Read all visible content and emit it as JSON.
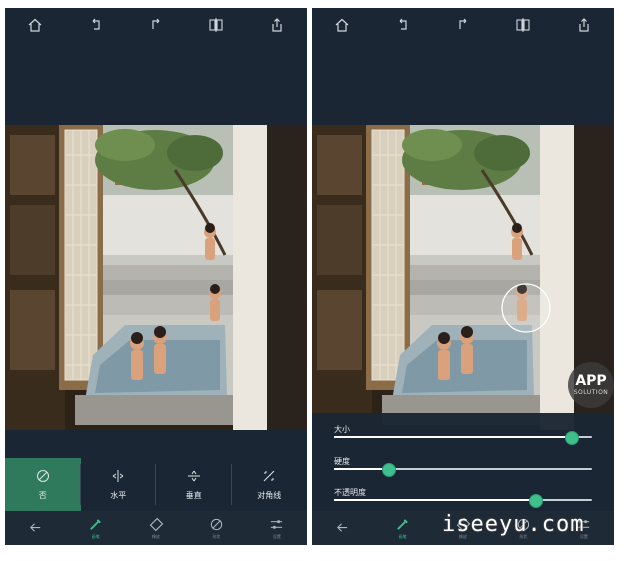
{
  "top_toolbar": {
    "icons": [
      "home-icon",
      "undo-icon",
      "redo-icon",
      "compare-icon",
      "share-icon"
    ]
  },
  "left_panel": {
    "options": [
      {
        "label": "否",
        "icon": "none-circle-icon",
        "active": true
      },
      {
        "label": "水平",
        "icon": "horizontal-mirror-icon",
        "active": false
      },
      {
        "label": "垂直",
        "icon": "vertical-mirror-icon",
        "active": false
      },
      {
        "label": "对角线",
        "icon": "diagonal-icon",
        "active": false
      }
    ]
  },
  "bottom_nav": {
    "items": [
      {
        "icon": "back-arrow-icon",
        "label": ""
      },
      {
        "icon": "brush-icon",
        "label": "画笔"
      },
      {
        "icon": "eraser-icon",
        "label": "橡皮"
      },
      {
        "icon": "circle-slash-icon",
        "label": "形状"
      },
      {
        "icon": "sliders-icon",
        "label": "设置"
      }
    ]
  },
  "right_panel": {
    "sliders": [
      {
        "label": "大小",
        "value": 0.92
      },
      {
        "label": "硬度",
        "value": 0.21
      },
      {
        "label": "不透明度",
        "value": 0.78
      }
    ]
  },
  "watermark": {
    "badge_main": "APP",
    "badge_sub": "SOLUTION",
    "site": "iseeyu.com"
  },
  "colors": {
    "background": "#1b2634",
    "accent": "#3fbf8c",
    "active_option": "#2f7a5c"
  }
}
